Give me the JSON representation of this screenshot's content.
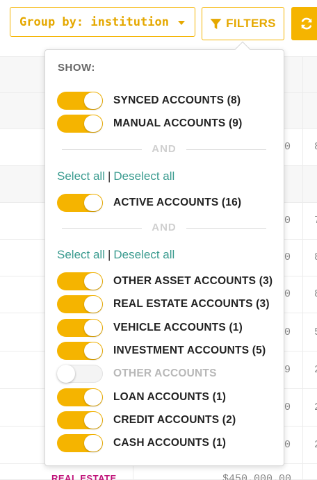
{
  "toolbar": {
    "group_by_label": "Group by: institution",
    "filters_label": "FILTERS",
    "icons": {
      "filter": "filter-icon",
      "refresh": "refresh-icon",
      "caret": "caret-down-icon"
    },
    "accent_color": "#f5b400"
  },
  "background_table": {
    "cells": [
      "0",
      "8",
      "0",
      "7",
      "0",
      "8",
      "0",
      "8",
      "0",
      "5",
      "9",
      "2",
      "0",
      "2",
      "0",
      "2"
    ],
    "bottom_tag": "REAL ESTATE",
    "bottom_amount": "$450,000.00"
  },
  "filters_panel": {
    "show_title": "SHOW:",
    "group1": [
      {
        "label": "SYNCED ACCOUNTS (8)",
        "on": true
      },
      {
        "label": "MANUAL ACCOUNTS (9)",
        "on": true
      }
    ],
    "and_label_1": "AND",
    "select_all_1": "Select all",
    "separator_1": "|",
    "deselect_all_1": "Deselect all",
    "group2": [
      {
        "label": "ACTIVE ACCOUNTS (16)",
        "on": true
      }
    ],
    "and_label_2": "AND",
    "select_all_2": "Select all",
    "separator_2": "|",
    "deselect_all_2": "Deselect all",
    "group3": [
      {
        "label": "OTHER ASSET ACCOUNTS (3)",
        "on": true
      },
      {
        "label": "REAL ESTATE ACCOUNTS (3)",
        "on": true
      },
      {
        "label": "VEHICLE ACCOUNTS (1)",
        "on": true
      },
      {
        "label": "INVESTMENT ACCOUNTS (5)",
        "on": true
      },
      {
        "label": "OTHER ACCOUNTS",
        "on": false
      },
      {
        "label": "LOAN ACCOUNTS (1)",
        "on": true
      },
      {
        "label": "CREDIT ACCOUNTS (2)",
        "on": true
      },
      {
        "label": "CASH ACCOUNTS (1)",
        "on": true
      }
    ],
    "link_color": "#3a9b8f"
  }
}
